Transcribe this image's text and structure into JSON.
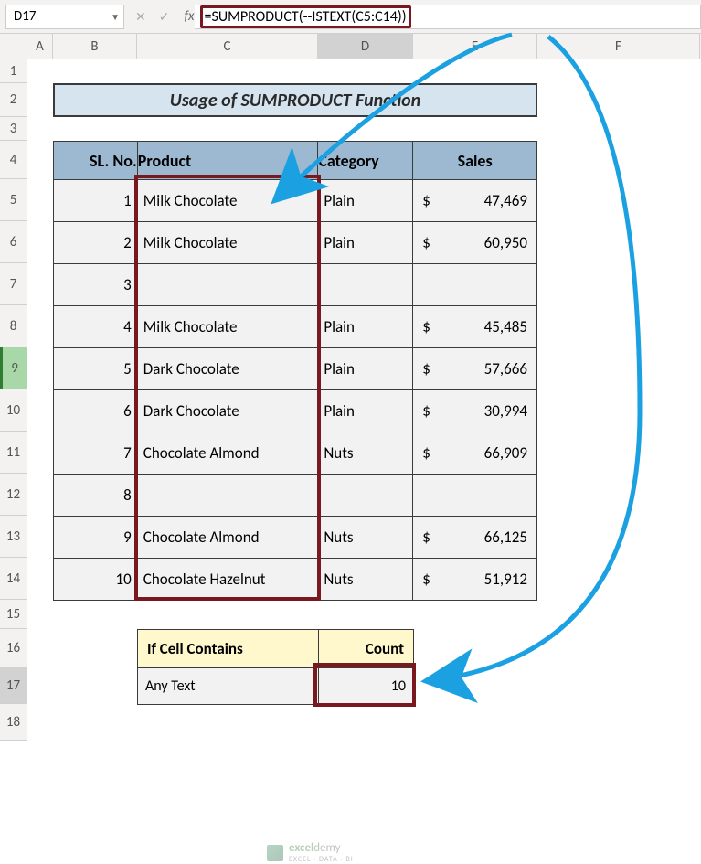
{
  "name_box": "D17",
  "formula": "=SUMPRODUCT(--ISTEXT(C5:C14))",
  "columns": [
    "A",
    "B",
    "C",
    "D",
    "E",
    "F"
  ],
  "rows": [
    "1",
    "2",
    "3",
    "4",
    "5",
    "6",
    "7",
    "8",
    "9",
    "10",
    "11",
    "12",
    "13",
    "14",
    "15",
    "16",
    "17",
    "18"
  ],
  "title": "Usage of SUMPRODUCT Function",
  "headers": {
    "sl": "SL. No.",
    "product": "Product",
    "category": "Category",
    "sales": "Sales"
  },
  "data": [
    {
      "sl": "1",
      "product": "Milk Chocolate",
      "category": "Plain",
      "currency": "$",
      "sales": "47,469"
    },
    {
      "sl": "2",
      "product": "Milk Chocolate",
      "category": "Plain",
      "currency": "$",
      "sales": "60,950"
    },
    {
      "sl": "3",
      "product": "",
      "category": "",
      "currency": "",
      "sales": ""
    },
    {
      "sl": "4",
      "product": "Milk Chocolate",
      "category": "Plain",
      "currency": "$",
      "sales": "45,485"
    },
    {
      "sl": "5",
      "product": "Dark Chocolate",
      "category": "Plain",
      "currency": "$",
      "sales": "57,666"
    },
    {
      "sl": "6",
      "product": "Dark Chocolate",
      "category": "Plain",
      "currency": "$",
      "sales": "30,994"
    },
    {
      "sl": "7",
      "product": "Chocolate Almond",
      "category": "Nuts",
      "currency": "$",
      "sales": "66,909"
    },
    {
      "sl": "8",
      "product": "",
      "category": "",
      "currency": "",
      "sales": ""
    },
    {
      "sl": "9",
      "product": "Chocolate Almond",
      "category": "Nuts",
      "currency": "$",
      "sales": "66,125"
    },
    {
      "sl": "10",
      "product": "Chocolate Hazelnut",
      "category": "Nuts",
      "currency": "$",
      "sales": "51,912"
    }
  ],
  "summary": {
    "header1": "If Cell Contains",
    "header2": "Count",
    "label": "Any Text",
    "value": "10"
  },
  "watermark": {
    "brand_prefix": "excel",
    "brand_suffix": "demy",
    "tagline": "EXCEL · DATA · BI"
  }
}
